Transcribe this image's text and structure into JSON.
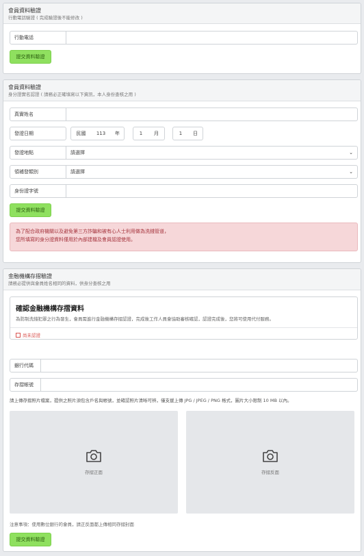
{
  "phone_section": {
    "title": "會員資料驗證",
    "subtitle": "行動電話驗證 ( 完成驗證後不能修改 )",
    "phone_label": "行動電話",
    "phone_value": "",
    "submit_label": "提交資料驗證"
  },
  "identity_section": {
    "title": "會員資料驗證",
    "subtitle": "身分證實名認證 ( 請務必正確填寫以下資訊，本人身份查核之用 )",
    "real_name_label": "真實姓名",
    "real_name_value": "",
    "issue_date_label": "發證日期",
    "era_label": "民國",
    "year_value": "113",
    "year_unit": "年",
    "month_value": "1",
    "month_unit": "月",
    "day_value": "1",
    "day_unit": "日",
    "issue_place_label": "發證地點",
    "issue_place_value": "請選擇",
    "issue_type_label": "領補發類別",
    "issue_type_value": "請選擇",
    "id_number_label": "身份證字號",
    "id_number_value": "",
    "submit_label": "提交資料驗證",
    "alert_line1": "為了配合政府機關以及避免第三方詐騙和被有心人士利用做為洗錢管道，",
    "alert_line2": "您所填寫的身分證資料僅用於內部建檔及會員認證使用。"
  },
  "bank_section": {
    "title": "金融機構存摺驗證",
    "subtitle": "請務必提供與會員姓名相同的資料，供身分查核之用",
    "info_title": "確認金融機構存摺資料",
    "info_text": "為防制洗錢犯罪之行為發生，會員需進行金融機構存摺認證，完成後工作人員會協助審核確認，認證完成後，您將可使用代付服務。",
    "status_text": "尚未認證",
    "bank_code_label": "銀行代碼",
    "bank_code_value": "",
    "account_label": "存摺帳號",
    "account_value": "",
    "upload_instructions": "請上傳存摺照片檔案，提供之照片須包含戶名與帳號，並確認照片清晰可辨，僅支援上傳 JPG / JPEG / PNG 格式，圖片大小限制 10 MB 以內。",
    "front_label": "存摺正面",
    "back_label": "存摺反面",
    "note": "注意事項：使用數位銀行的會員，請正反面都上傳相同存摺封面",
    "submit_label": "提交資料驗證"
  },
  "icons": {
    "select_chevron": "chevron-down-icon",
    "upload": "camera-icon",
    "status": "checkbox-icon"
  },
  "colors": {
    "button_bg": "#8fe05f",
    "alert_bg": "#f6d7d9",
    "alert_text": "#a5333c",
    "status_red": "#d9534f"
  }
}
